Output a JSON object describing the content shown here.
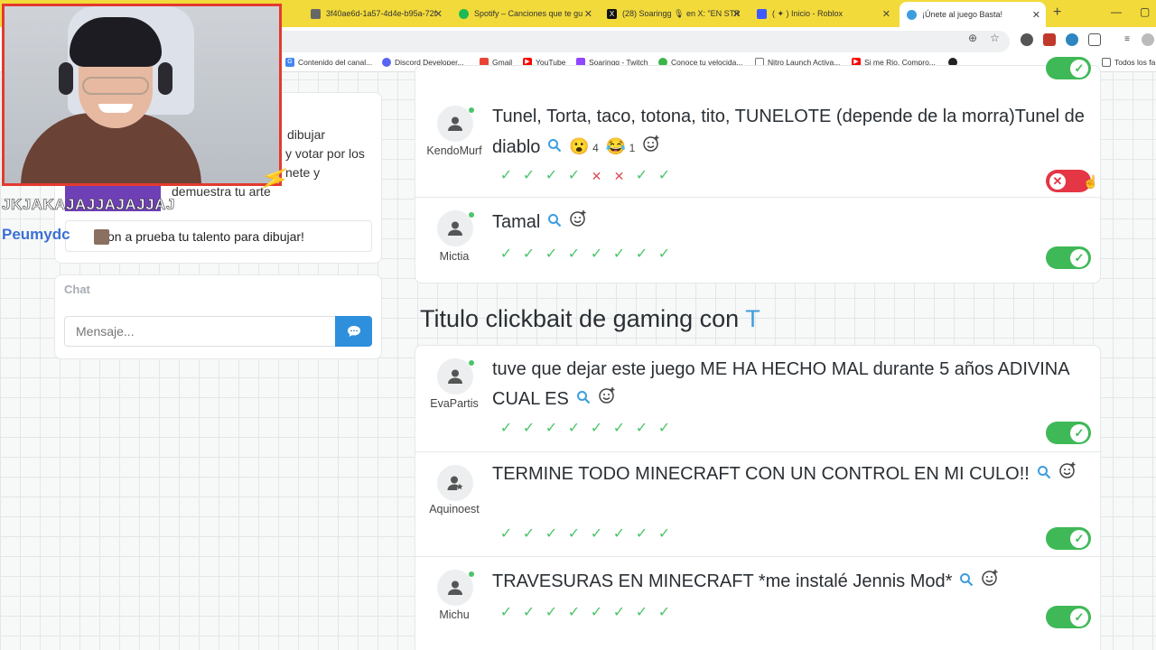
{
  "browser": {
    "tabs": [
      {
        "label": "3f40ae6d-1a57-4d4e-b95a-72f",
        "icon": "doc-icon",
        "color": "#666666"
      },
      {
        "label": "Spotify – Canciones que te gu",
        "icon": "spotify-icon",
        "color": "#1db954"
      },
      {
        "label": "(28) Soaringg 🎙 en X: \"EN STR",
        "icon": "x-icon",
        "color": "#111111"
      },
      {
        "label": "( ✦ ) Inicio - Roblox",
        "icon": "roblox-icon",
        "color": "#3d5afe"
      },
      {
        "label": "¡Únete al juego Basta!",
        "icon": "basta-icon",
        "color": "#3d9de0"
      }
    ],
    "bookmarks": [
      {
        "label": "Contenido del canal...",
        "icon": "google-icon",
        "color": "#4285f4"
      },
      {
        "label": "Discord Developer...",
        "icon": "discord-icon",
        "color": "#5865f2"
      },
      {
        "label": "Gmail",
        "icon": "gmail-icon",
        "color": "#ea4335"
      },
      {
        "label": "YouTube",
        "icon": "youtube-icon",
        "color": "#ff0000"
      },
      {
        "label": "Soaringg - Twitch",
        "icon": "twitch-icon",
        "color": "#9146ff"
      },
      {
        "label": "Conoce tu velocida...",
        "icon": "speed-icon",
        "color": "#3bb54a"
      },
      {
        "label": "Nitro Launch Activa...",
        "icon": "nitro-icon",
        "color": "#777777"
      },
      {
        "label": "Si me Rio, Compro...",
        "icon": "youtube-icon",
        "color": "#ff0000"
      },
      {
        "label": "Todos los fa",
        "icon": "folder-icon",
        "color": "#666666"
      }
    ]
  },
  "left": {
    "rules_line1": "dibujar",
    "rules_line2": "y votar por los",
    "rules_line3": "nete y",
    "rules_line4": "demuestra tu arte",
    "overlay_message": "JKJAKAJAJJAJAJJAJ",
    "overlay_user": "Peumydc",
    "notice": "¡Pon a prueba tu talento para dibujar!",
    "chat_label": "Chat",
    "message_placeholder": "Mensaje..."
  },
  "category": {
    "title": "Titulo clickbait de gaming con ",
    "letter": "T"
  },
  "rows_top": [
    {
      "player": "KendoMurf",
      "answer": "Tunel, Torta, taco, totona, tito, TUNELOTE (depende de la morra)Tunel de diablo",
      "reactions": [
        {
          "emoji": "😮",
          "count": "4"
        },
        {
          "emoji": "😂",
          "count": "1"
        }
      ],
      "votes": [
        "ok",
        "ok",
        "ok",
        "ok",
        "no",
        "no",
        "ok",
        "ok"
      ],
      "valid": false
    },
    {
      "player": "Mictia",
      "answer": "Tamal",
      "reactions": [],
      "votes": [
        "ok",
        "ok",
        "ok",
        "ok",
        "ok",
        "ok",
        "ok",
        "ok"
      ],
      "valid": true
    }
  ],
  "rows_bottom": [
    {
      "player": "EvaPartis",
      "answer": "tuve que dejar este juego ME HA HECHO MAL durante 5 años ADIVINA CUAL ES",
      "votes": [
        "ok",
        "ok",
        "ok",
        "ok",
        "ok",
        "ok",
        "ok",
        "ok"
      ],
      "valid": true
    },
    {
      "player": "Aquinoest",
      "answer": "TERMINE TODO MINECRAFT CON UN CONTROL EN MI CULO!!",
      "votes": [
        "ok",
        "ok",
        "ok",
        "ok",
        "ok",
        "ok",
        "ok",
        "ok"
      ],
      "valid": true
    },
    {
      "player": "Michu",
      "answer": "TRAVESURAS EN MINECRAFT *me instalé Jennis Mod*",
      "votes": [
        "ok",
        "ok",
        "ok",
        "ok",
        "ok",
        "ok",
        "ok",
        "ok"
      ],
      "valid": true
    }
  ],
  "colors": {
    "accent": "#3d9de0",
    "valid": "#3fb957",
    "invalid": "#e43645",
    "tabbar": "#f2da3a",
    "webcam_border": "#e33a2f"
  }
}
